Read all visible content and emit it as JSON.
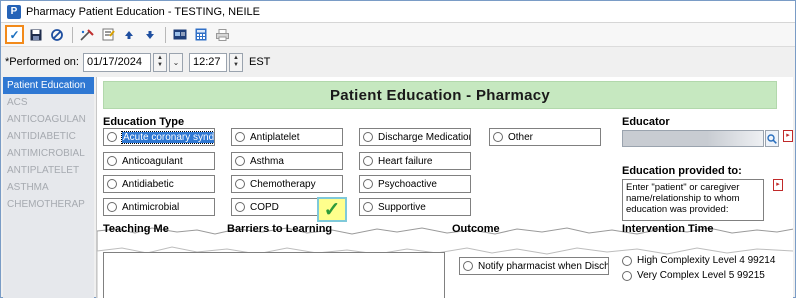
{
  "window": {
    "title": "Pharmacy Patient Education - TESTING, NEILE",
    "app_icon_letter": "P"
  },
  "toolbar": {
    "icons": [
      "checkmark-icon",
      "save-icon",
      "cancel-icon",
      "tools-icon",
      "form-icon",
      "up-arrow-icon",
      "down-arrow-icon",
      "card-icon",
      "calculator-icon",
      "print-icon"
    ]
  },
  "performed": {
    "label": "*Performed on:",
    "date": "01/17/2024",
    "time": "12:27",
    "timezone": "EST"
  },
  "sidebar": {
    "items": [
      {
        "label": "Patient Education",
        "active": true
      },
      {
        "label": "ACS",
        "active": false
      },
      {
        "label": "ANTICOAGULAN",
        "active": false
      },
      {
        "label": "ANTIDIABETIC",
        "active": false
      },
      {
        "label": "ANTIMICROBIAL",
        "active": false
      },
      {
        "label": "ANTIPLATELET",
        "active": false
      },
      {
        "label": "ASTHMA",
        "active": false
      },
      {
        "label": "CHEMOTHERAP",
        "active": false
      }
    ]
  },
  "main": {
    "banner": "Patient Education - Pharmacy",
    "education_type": {
      "heading": "Education Type",
      "options": [
        "Acute coronary syndrome",
        "Antiplatelet",
        "Discharge Medications",
        "Other",
        "Anticoagulant",
        "Asthma",
        "Heart failure",
        "Antidiabetic",
        "Chemotherapy",
        "Psychoactive",
        "Antimicrobial",
        "COPD",
        "Supportive"
      ]
    },
    "educator": {
      "heading": "Educator"
    },
    "provided_to": {
      "heading": "Education provided to:",
      "placeholder": "Enter \"patient\" or caregiver name/relationship to whom education was provided:"
    },
    "lower": {
      "teaching_heading": "Teaching Me",
      "barriers_heading": "Barriers to Learning",
      "outcome_heading": "Outcome",
      "intervention_heading": "Intervention Time",
      "notify_option": "Notify pharmacist when Discharged",
      "intervention_options": [
        "High Complexity  Level 4  99214",
        "Very Complex  Level 5  99215"
      ]
    }
  },
  "colors": {
    "banner_bg": "#c6e8c0",
    "nav_active": "#2f78d3",
    "check_highlight": "#ffff8c",
    "toolbar_check_border": "#f28a1a"
  }
}
